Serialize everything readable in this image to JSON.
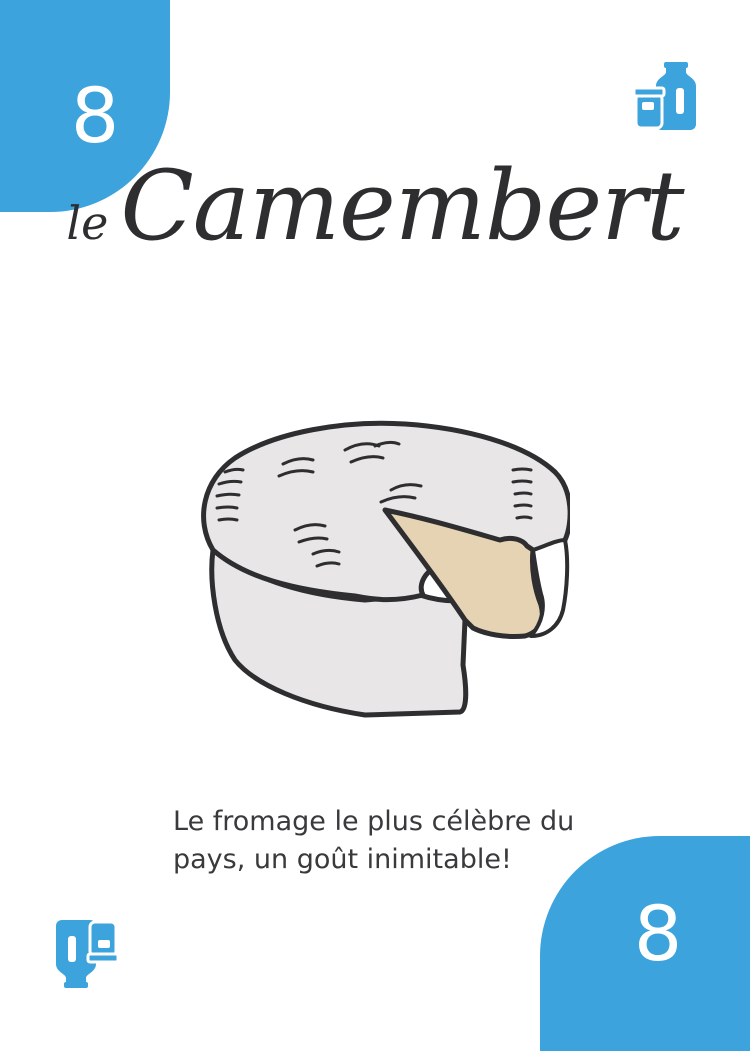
{
  "card": {
    "number_top": "8",
    "number_bottom": "8",
    "title_article": "le",
    "title_name": "Camembert",
    "description_line1": "Le fromage le plus célèbre du",
    "description_line2": "pays, un goût inimitable!"
  },
  "icons": {
    "top_right": "dairy-products-icon",
    "bottom_left": "dairy-products-icon",
    "illustration": "camembert-cheese-illustration"
  },
  "colors": {
    "accent": "#3ca3dc",
    "ink": "#2e2e30",
    "rind": "#e8e6e6",
    "paste": "#e6d3b3"
  }
}
